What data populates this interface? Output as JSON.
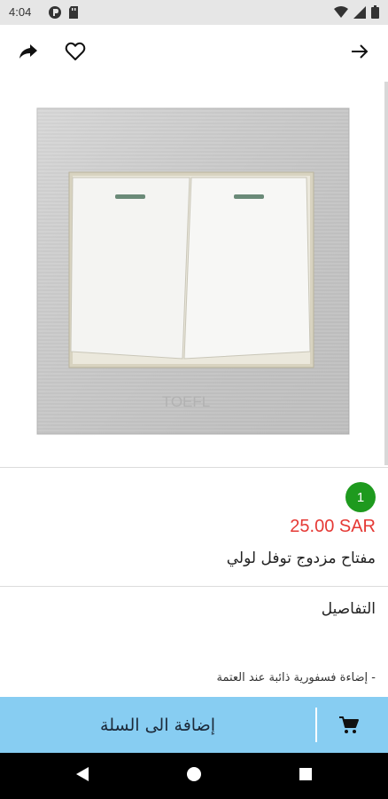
{
  "status_bar": {
    "time": "4:04",
    "left_icons": [
      "vpn-icon",
      "sd-card-icon"
    ],
    "right_icons": [
      "wifi-icon",
      "signal-icon",
      "battery-icon"
    ]
  },
  "app_bar": {
    "icons": [
      "share-icon",
      "heart-icon",
      "arrow-forward-icon"
    ]
  },
  "product": {
    "image_icon": "double-light-switch-image",
    "image_brand": "TOEFL",
    "quantity_badge": "1",
    "price": "25.00 SAR",
    "name": "مفتاح مزدوج توفل لولي"
  },
  "details": {
    "title": "التفاصيل",
    "lines": [
      "- إضاءة فسفورية ذائبة عند العتمة"
    ]
  },
  "bottom_bar": {
    "add_to_cart_label": "إضافة الى السلة",
    "cart_icon": "cart-icon"
  },
  "nav_bar": {
    "icons": [
      "back-triangle-icon",
      "home-circle-icon",
      "recents-square-icon"
    ]
  },
  "colors": {
    "price": "#e53935",
    "badge": "#1e9a1e",
    "cart_bar": "#87cdf2",
    "status_bar": "#e6e6e6",
    "nav_bar": "#000000"
  }
}
